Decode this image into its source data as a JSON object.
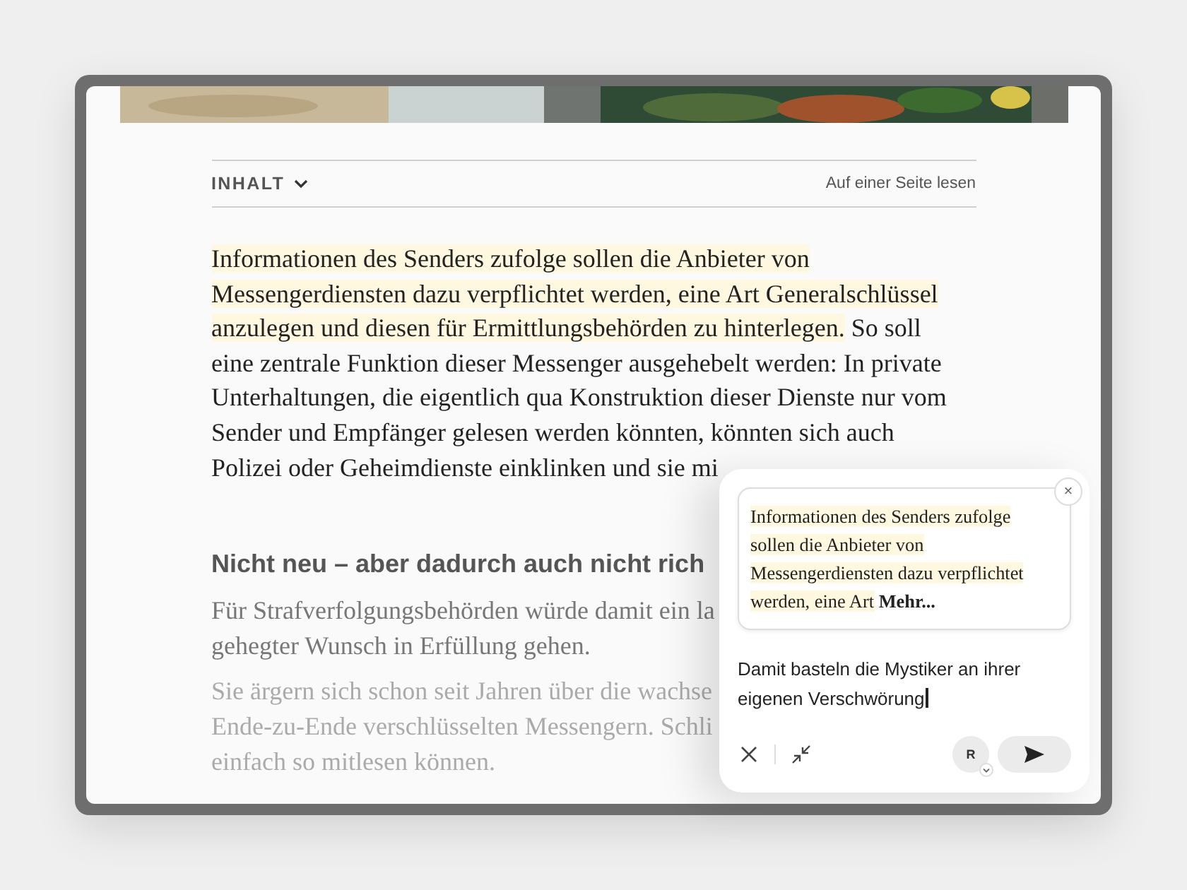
{
  "toc": {
    "label": "INHALT",
    "link": "Auf einer Seite lesen"
  },
  "article": {
    "intro": {
      "highlighted": "Informationen des Senders zufolge sollen die Anbieter von Messengerdiensten dazu verpflichtet werden, eine Art Generalschlüssel anzulegen und diesen für Ermittlungsbehörden zu hinterlegen.",
      "rest": " So soll eine zentrale Funktion dieser Messenger ausgehebelt werden: In private Unterhaltungen, die eigentlich qua Konstruktion dieser Dienste nur vom Sender und Empfänger gelesen werden könnten, könnten sich auch Polizei oder Geheimdienste einklinken und sie mi"
    },
    "heading": "Nicht neu – aber dadurch auch nicht rich",
    "paragraphs": [
      {
        "lines": [
          "Für Strafverfolgungsbehörden würde damit ein la",
          "gehegter Wunsch in Erfüllung gehen."
        ]
      },
      {
        "lines": [
          "Sie ärgern sich schon seit Jahren über die wachse",
          "Ende-zu-Ende verschlüsselten Messengern. Schli",
          "einfach so mitlesen können."
        ]
      }
    ]
  },
  "popup": {
    "quote": "Informationen des Senders zufolge sollen die Anbieter von Messengerdiensten dazu verpflichtet werden, eine Art",
    "more": "Mehr...",
    "close": "×",
    "input": "Damit basteln die Mystiker an ihrer eigenen Verschwörung",
    "avatar": "R"
  }
}
